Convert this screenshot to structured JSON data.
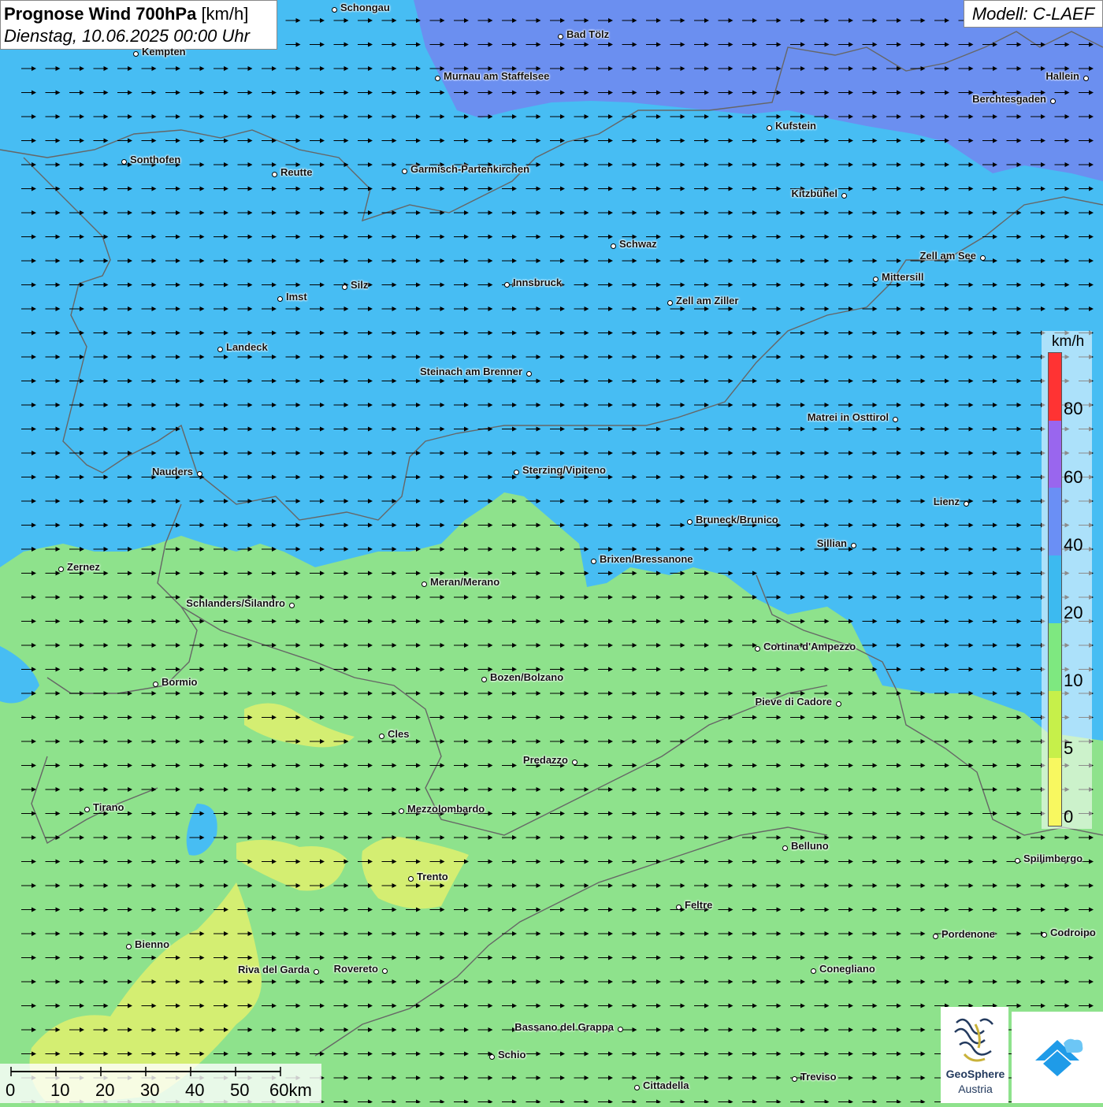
{
  "title": {
    "bold": "Prognose Wind 700hPa",
    "unit": "[km/h]",
    "date": "Dienstag, 10.06.2025 00:00 Uhr"
  },
  "model": "Modell: C-LAEF",
  "legend": {
    "unit": "km/h",
    "labels": [
      "80",
      "60",
      "40",
      "20",
      "10",
      "5",
      "0"
    ],
    "colors": [
      "#ff3333",
      "#9966ee",
      "#6a8ff5",
      "#3cbaf0",
      "#7ee880",
      "#c6f04a",
      "#f8f860"
    ],
    "fill_colors": {
      "low": "#8ee28c",
      "mid": "#47bdf3",
      "high": "#6b8ff0",
      "yellow": "#d4ee72"
    }
  },
  "wind_direction_deg": 0,
  "cities": [
    {
      "name": "Schongau",
      "id": "schongau"
    },
    {
      "name": "Bad Tölz",
      "id": "bad-toelz"
    },
    {
      "name": "Kempten",
      "id": "kempten"
    },
    {
      "name": "Murnau am Staffelsee",
      "id": "murnau"
    },
    {
      "name": "Hallein",
      "id": "hallein"
    },
    {
      "name": "Berchtesgaden",
      "id": "berchtesgaden"
    },
    {
      "name": "Kufstein",
      "id": "kufstein"
    },
    {
      "name": "Sonthofen",
      "id": "sonthofen"
    },
    {
      "name": "Reutte",
      "id": "reutte"
    },
    {
      "name": "Garmisch-Partenkirchen",
      "id": "garmisch"
    },
    {
      "name": "Kitzbühel",
      "id": "kitzbuehel"
    },
    {
      "name": "Schwaz",
      "id": "schwaz"
    },
    {
      "name": "Zell am See",
      "id": "zell-am-see"
    },
    {
      "name": "Mittersill",
      "id": "mittersill"
    },
    {
      "name": "Innsbruck",
      "id": "innsbruck"
    },
    {
      "name": "Silz",
      "id": "silz"
    },
    {
      "name": "Imst",
      "id": "imst"
    },
    {
      "name": "Zell am Ziller",
      "id": "zell-am-ziller"
    },
    {
      "name": "Landeck",
      "id": "landeck"
    },
    {
      "name": "Steinach am Brenner",
      "id": "steinach"
    },
    {
      "name": "Matrei in Osttirol",
      "id": "matrei"
    },
    {
      "name": "Nauders",
      "id": "nauders"
    },
    {
      "name": "Sterzing/Vipiteno",
      "id": "sterzing"
    },
    {
      "name": "Lienz",
      "id": "lienz"
    },
    {
      "name": "Bruneck/Brunico",
      "id": "bruneck"
    },
    {
      "name": "Sillian",
      "id": "sillian"
    },
    {
      "name": "Brixen/Bressanone",
      "id": "brixen"
    },
    {
      "name": "Zernez",
      "id": "zernez"
    },
    {
      "name": "Meran/Merano",
      "id": "meran"
    },
    {
      "name": "Schlanders/Silandro",
      "id": "schlanders"
    },
    {
      "name": "Cortina d'Ampezzo",
      "id": "cortina"
    },
    {
      "name": "Bormio",
      "id": "bormio"
    },
    {
      "name": "Bozen/Bolzano",
      "id": "bozen"
    },
    {
      "name": "Pieve di Cadore",
      "id": "pieve"
    },
    {
      "name": "Cles",
      "id": "cles"
    },
    {
      "name": "Predazzo",
      "id": "predazzo"
    },
    {
      "name": "Tirano",
      "id": "tirano"
    },
    {
      "name": "Mezzolombardo",
      "id": "mezzolombardo"
    },
    {
      "name": "Belluno",
      "id": "belluno"
    },
    {
      "name": "Spilimbergo",
      "id": "spilimbergo"
    },
    {
      "name": "Trento",
      "id": "trento"
    },
    {
      "name": "Feltre",
      "id": "feltre"
    },
    {
      "name": "Pordenone",
      "id": "pordenone"
    },
    {
      "name": "Codroipo",
      "id": "codroipo"
    },
    {
      "name": "Bienno",
      "id": "bienno"
    },
    {
      "name": "Riva del Garda",
      "id": "riva"
    },
    {
      "name": "Rovereto",
      "id": "rovereto"
    },
    {
      "name": "Conegliano",
      "id": "conegliano"
    },
    {
      "name": "Bassano del Grappa",
      "id": "bassano"
    },
    {
      "name": "Schio",
      "id": "schio"
    },
    {
      "name": "Treviso",
      "id": "treviso"
    },
    {
      "name": "Cittadella",
      "id": "cittadella"
    }
  ],
  "scale": {
    "labels": [
      "0",
      "10",
      "20",
      "30",
      "40",
      "50",
      "60km"
    ]
  },
  "logo": {
    "line1": "GeoSphere",
    "line2": "Austria"
  }
}
